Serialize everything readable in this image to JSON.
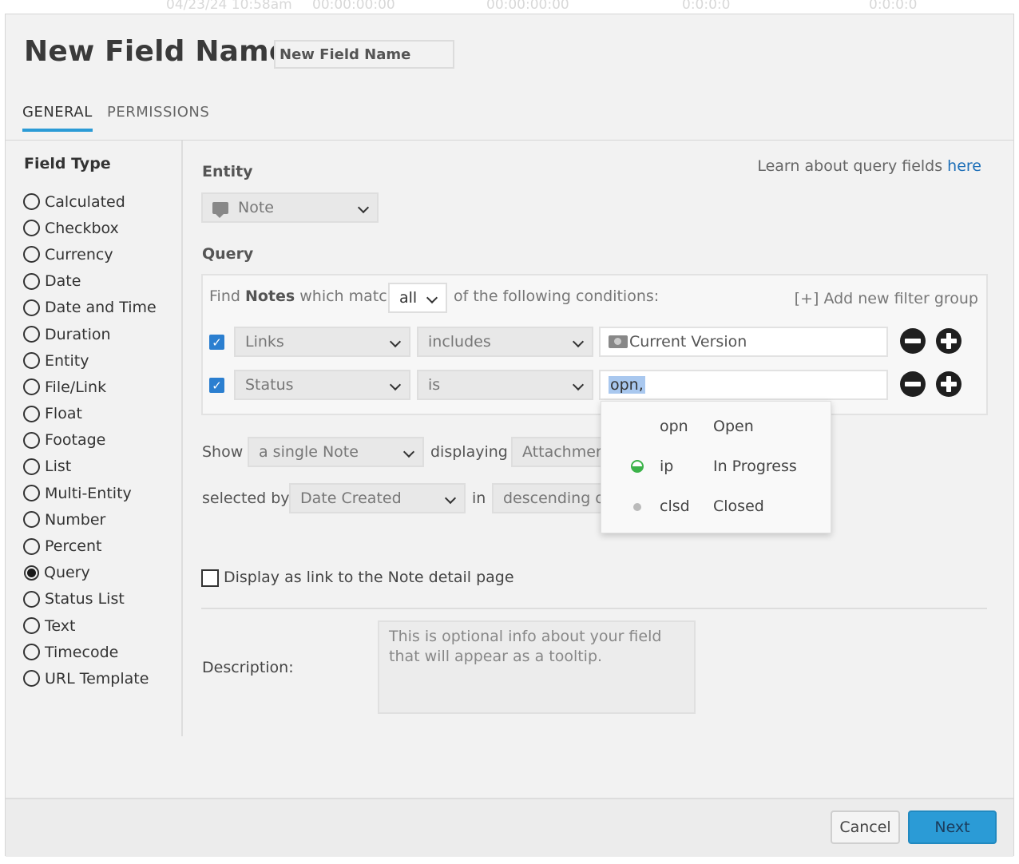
{
  "background_row": [
    "04/23/24 10:58am",
    "00:00:00:00",
    "00:00:00:00",
    "0:0:0:0",
    "0:0:0:0"
  ],
  "dialog": {
    "title": "New Field Name",
    "title_input_value": "New Field Name"
  },
  "tabs": [
    {
      "label": "GENERAL",
      "active": true
    },
    {
      "label": "PERMISSIONS",
      "active": false
    }
  ],
  "field_type": {
    "heading": "Field Type",
    "selected": "Query",
    "options": [
      "Calculated",
      "Checkbox",
      "Currency",
      "Date",
      "Date and Time",
      "Duration",
      "Entity",
      "File/Link",
      "Float",
      "Footage",
      "List",
      "Multi-Entity",
      "Number",
      "Percent",
      "Query",
      "Status List",
      "Text",
      "Timecode",
      "URL Template"
    ]
  },
  "learn": {
    "text": "Learn about query fields ",
    "link": "here"
  },
  "entity": {
    "label": "Entity",
    "value": "Note",
    "icon": "note-icon"
  },
  "query": {
    "label": "Query",
    "find_prefix": "Find ",
    "find_entity": "Notes",
    "find_middle": " which match",
    "match_value": "all",
    "find_suffix": "of the following conditions:",
    "add_filter_group": "[+] Add new filter group",
    "conditions": [
      {
        "checked": true,
        "field": "Links",
        "operator": "includes",
        "value": "Current Version",
        "value_icon": "version-icon"
      },
      {
        "checked": true,
        "field": "Status",
        "operator": "is",
        "value": "opn,"
      }
    ],
    "status_dropdown": [
      {
        "code": "opn",
        "name": "Open",
        "icon": ""
      },
      {
        "code": "ip",
        "name": "In Progress",
        "icon": "in-progress-icon"
      },
      {
        "code": "clsd",
        "name": "Closed",
        "icon": "closed-dot-icon"
      }
    ]
  },
  "show": {
    "show_label": "Show",
    "show_value": "a single Note",
    "displaying_label": "displaying",
    "displaying_value": "Attachmen",
    "selected_by_label": "selected by",
    "selected_by_value": "Date Created",
    "in_label": "in",
    "order_value": "descending o"
  },
  "display_link": {
    "checked": false,
    "label": "Display as link to the Note detail page"
  },
  "description": {
    "label": "Description:",
    "placeholder": "This is optional info about your field that will appear as a tooltip."
  },
  "footer": {
    "cancel_label": "Cancel",
    "next_label": "Next"
  },
  "colors": {
    "accent": "#2b9bd6",
    "link": "#1d6fb8",
    "checkbox": "#2b7fd0",
    "in_progress": "#3cb34a"
  }
}
